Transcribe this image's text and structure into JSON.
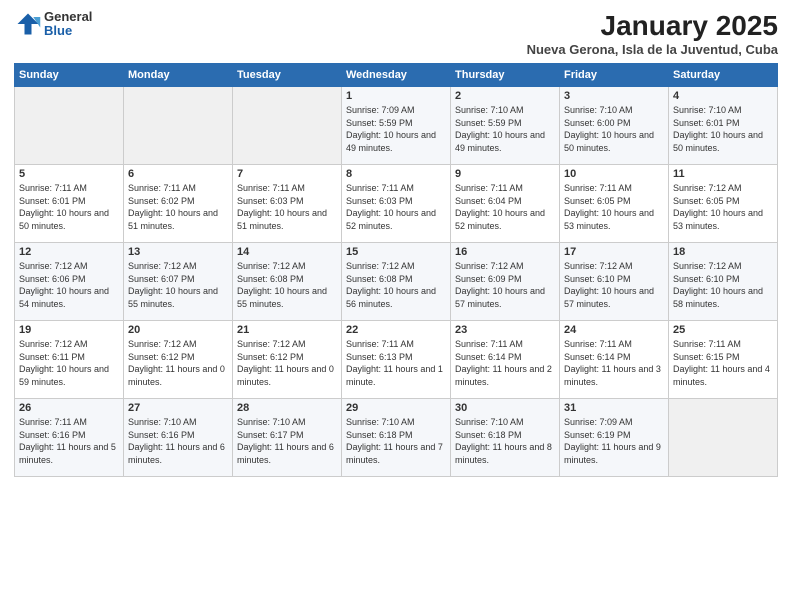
{
  "header": {
    "logo_general": "General",
    "logo_blue": "Blue",
    "month": "January 2025",
    "location": "Nueva Gerona, Isla de la Juventud, Cuba"
  },
  "weekdays": [
    "Sunday",
    "Monday",
    "Tuesday",
    "Wednesday",
    "Thursday",
    "Friday",
    "Saturday"
  ],
  "weeks": [
    [
      {
        "day": "",
        "sunrise": "",
        "sunset": "",
        "daylight": ""
      },
      {
        "day": "",
        "sunrise": "",
        "sunset": "",
        "daylight": ""
      },
      {
        "day": "",
        "sunrise": "",
        "sunset": "",
        "daylight": ""
      },
      {
        "day": "1",
        "sunrise": "Sunrise: 7:09 AM",
        "sunset": "Sunset: 5:59 PM",
        "daylight": "Daylight: 10 hours and 49 minutes."
      },
      {
        "day": "2",
        "sunrise": "Sunrise: 7:10 AM",
        "sunset": "Sunset: 5:59 PM",
        "daylight": "Daylight: 10 hours and 49 minutes."
      },
      {
        "day": "3",
        "sunrise": "Sunrise: 7:10 AM",
        "sunset": "Sunset: 6:00 PM",
        "daylight": "Daylight: 10 hours and 50 minutes."
      },
      {
        "day": "4",
        "sunrise": "Sunrise: 7:10 AM",
        "sunset": "Sunset: 6:01 PM",
        "daylight": "Daylight: 10 hours and 50 minutes."
      }
    ],
    [
      {
        "day": "5",
        "sunrise": "Sunrise: 7:11 AM",
        "sunset": "Sunset: 6:01 PM",
        "daylight": "Daylight: 10 hours and 50 minutes."
      },
      {
        "day": "6",
        "sunrise": "Sunrise: 7:11 AM",
        "sunset": "Sunset: 6:02 PM",
        "daylight": "Daylight: 10 hours and 51 minutes."
      },
      {
        "day": "7",
        "sunrise": "Sunrise: 7:11 AM",
        "sunset": "Sunset: 6:03 PM",
        "daylight": "Daylight: 10 hours and 51 minutes."
      },
      {
        "day": "8",
        "sunrise": "Sunrise: 7:11 AM",
        "sunset": "Sunset: 6:03 PM",
        "daylight": "Daylight: 10 hours and 52 minutes."
      },
      {
        "day": "9",
        "sunrise": "Sunrise: 7:11 AM",
        "sunset": "Sunset: 6:04 PM",
        "daylight": "Daylight: 10 hours and 52 minutes."
      },
      {
        "day": "10",
        "sunrise": "Sunrise: 7:11 AM",
        "sunset": "Sunset: 6:05 PM",
        "daylight": "Daylight: 10 hours and 53 minutes."
      },
      {
        "day": "11",
        "sunrise": "Sunrise: 7:12 AM",
        "sunset": "Sunset: 6:05 PM",
        "daylight": "Daylight: 10 hours and 53 minutes."
      }
    ],
    [
      {
        "day": "12",
        "sunrise": "Sunrise: 7:12 AM",
        "sunset": "Sunset: 6:06 PM",
        "daylight": "Daylight: 10 hours and 54 minutes."
      },
      {
        "day": "13",
        "sunrise": "Sunrise: 7:12 AM",
        "sunset": "Sunset: 6:07 PM",
        "daylight": "Daylight: 10 hours and 55 minutes."
      },
      {
        "day": "14",
        "sunrise": "Sunrise: 7:12 AM",
        "sunset": "Sunset: 6:08 PM",
        "daylight": "Daylight: 10 hours and 55 minutes."
      },
      {
        "day": "15",
        "sunrise": "Sunrise: 7:12 AM",
        "sunset": "Sunset: 6:08 PM",
        "daylight": "Daylight: 10 hours and 56 minutes."
      },
      {
        "day": "16",
        "sunrise": "Sunrise: 7:12 AM",
        "sunset": "Sunset: 6:09 PM",
        "daylight": "Daylight: 10 hours and 57 minutes."
      },
      {
        "day": "17",
        "sunrise": "Sunrise: 7:12 AM",
        "sunset": "Sunset: 6:10 PM",
        "daylight": "Daylight: 10 hours and 57 minutes."
      },
      {
        "day": "18",
        "sunrise": "Sunrise: 7:12 AM",
        "sunset": "Sunset: 6:10 PM",
        "daylight": "Daylight: 10 hours and 58 minutes."
      }
    ],
    [
      {
        "day": "19",
        "sunrise": "Sunrise: 7:12 AM",
        "sunset": "Sunset: 6:11 PM",
        "daylight": "Daylight: 10 hours and 59 minutes."
      },
      {
        "day": "20",
        "sunrise": "Sunrise: 7:12 AM",
        "sunset": "Sunset: 6:12 PM",
        "daylight": "Daylight: 11 hours and 0 minutes."
      },
      {
        "day": "21",
        "sunrise": "Sunrise: 7:12 AM",
        "sunset": "Sunset: 6:12 PM",
        "daylight": "Daylight: 11 hours and 0 minutes."
      },
      {
        "day": "22",
        "sunrise": "Sunrise: 7:11 AM",
        "sunset": "Sunset: 6:13 PM",
        "daylight": "Daylight: 11 hours and 1 minute."
      },
      {
        "day": "23",
        "sunrise": "Sunrise: 7:11 AM",
        "sunset": "Sunset: 6:14 PM",
        "daylight": "Daylight: 11 hours and 2 minutes."
      },
      {
        "day": "24",
        "sunrise": "Sunrise: 7:11 AM",
        "sunset": "Sunset: 6:14 PM",
        "daylight": "Daylight: 11 hours and 3 minutes."
      },
      {
        "day": "25",
        "sunrise": "Sunrise: 7:11 AM",
        "sunset": "Sunset: 6:15 PM",
        "daylight": "Daylight: 11 hours and 4 minutes."
      }
    ],
    [
      {
        "day": "26",
        "sunrise": "Sunrise: 7:11 AM",
        "sunset": "Sunset: 6:16 PM",
        "daylight": "Daylight: 11 hours and 5 minutes."
      },
      {
        "day": "27",
        "sunrise": "Sunrise: 7:10 AM",
        "sunset": "Sunset: 6:16 PM",
        "daylight": "Daylight: 11 hours and 6 minutes."
      },
      {
        "day": "28",
        "sunrise": "Sunrise: 7:10 AM",
        "sunset": "Sunset: 6:17 PM",
        "daylight": "Daylight: 11 hours and 6 minutes."
      },
      {
        "day": "29",
        "sunrise": "Sunrise: 7:10 AM",
        "sunset": "Sunset: 6:18 PM",
        "daylight": "Daylight: 11 hours and 7 minutes."
      },
      {
        "day": "30",
        "sunrise": "Sunrise: 7:10 AM",
        "sunset": "Sunset: 6:18 PM",
        "daylight": "Daylight: 11 hours and 8 minutes."
      },
      {
        "day": "31",
        "sunrise": "Sunrise: 7:09 AM",
        "sunset": "Sunset: 6:19 PM",
        "daylight": "Daylight: 11 hours and 9 minutes."
      },
      {
        "day": "",
        "sunrise": "",
        "sunset": "",
        "daylight": ""
      }
    ]
  ]
}
